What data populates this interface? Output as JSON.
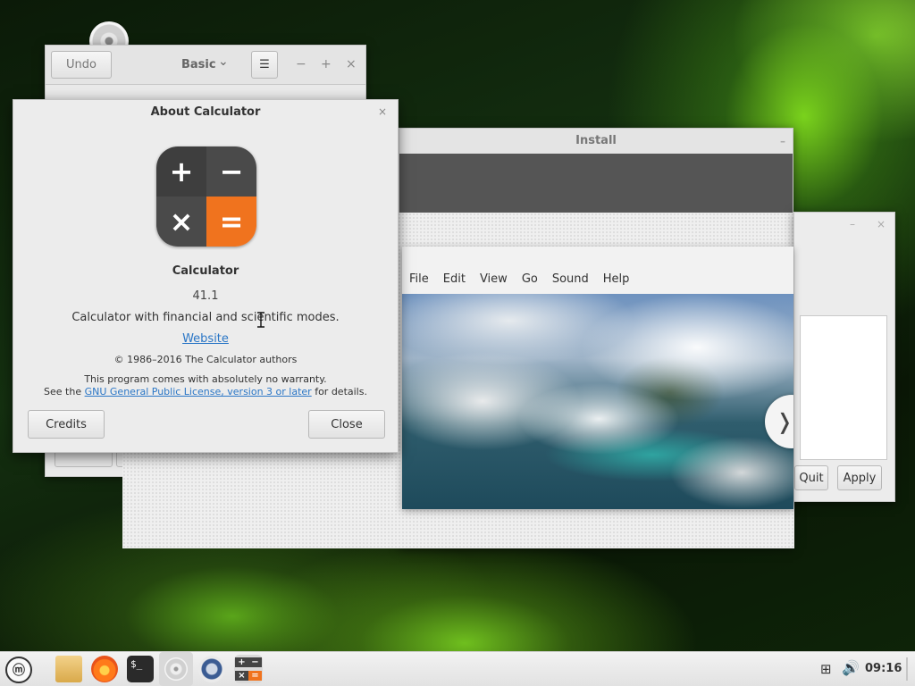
{
  "calculator_window": {
    "undo_label": "Undo",
    "mode_label": "Basic",
    "mode_chevron": "⌄",
    "menu_icon": "☰",
    "minimize": "−",
    "maximize": "+",
    "close": "×"
  },
  "install_window": {
    "title": "Install",
    "close": "–"
  },
  "settings_window": {
    "minimize": "–",
    "close": "×",
    "quit_label": "Quit",
    "apply_label": "Apply"
  },
  "video_player": {
    "menu": [
      "File",
      "Edit",
      "View",
      "Go",
      "Sound",
      "Help"
    ],
    "next_icon": "❭"
  },
  "about_dialog": {
    "title": "About Calculator",
    "close": "×",
    "app_name": "Calculator",
    "version": "41.1",
    "description": "Calculator with financial and scientific modes.",
    "website": "Website",
    "copyright": "© 1986–2016 The Calculator authors",
    "warranty": "This program comes with absolutely no warranty.",
    "license_prefix": "See the ",
    "license_link": "GNU General Public License, version 3 or later",
    "license_suffix": " for details.",
    "credits_label": "Credits",
    "close_label": "Close",
    "logo_plus": "+",
    "logo_minus": "−",
    "logo_times": "×",
    "logo_equals": "="
  },
  "taskbar": {
    "menu_icon": "ⓜ",
    "terminal_glyph": "$_",
    "calc_plus": "+",
    "calc_minus": "−",
    "calc_times": "×",
    "calc_equals": "=",
    "network_icon": "⊞",
    "volume_icon": "🔊",
    "clock": "09:16"
  },
  "colors": {
    "accent_orange": "#f0731e",
    "link_blue": "#2a76c6",
    "equals_green": "#3dae5f"
  }
}
